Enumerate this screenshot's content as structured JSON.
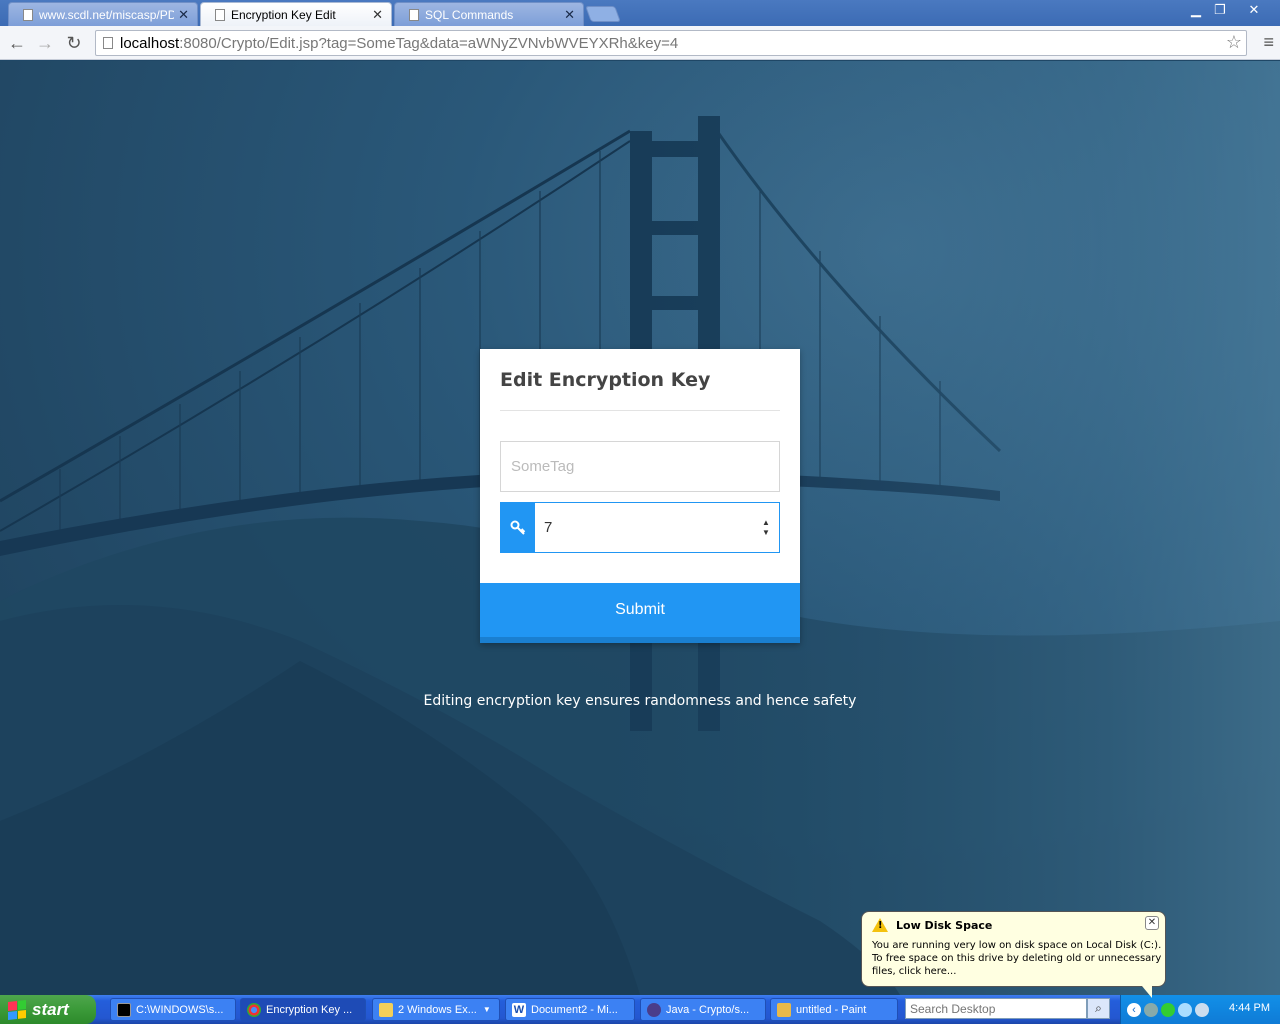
{
  "browser": {
    "tabs": [
      {
        "title": "www.scdl.net/miscasp/PDFS"
      },
      {
        "title": "Encryption Key Edit"
      },
      {
        "title": "SQL Commands"
      }
    ],
    "url_host": "localhost",
    "url_rest": ":8080/Crypto/Edit.jsp?tag=SomeTag&data=aWNyZVNvbWVEYXRh&key=4"
  },
  "form": {
    "title": "Edit Encryption Key",
    "tag_placeholder": "SomeTag",
    "key_value": "7",
    "submit_label": "Submit"
  },
  "tagline": "Editing encryption key ensures randomness and hence safety",
  "notification": {
    "title": "Low Disk Space",
    "body": "You are running very low on disk space on Local Disk (C:). To free space on this drive by deleting old or unnecessary files, click here..."
  },
  "taskbar": {
    "start_label": "start",
    "items": [
      {
        "label": "C:\\WINDOWS\\s..."
      },
      {
        "label": "Encryption Key ..."
      },
      {
        "label": "2 Windows Ex..."
      },
      {
        "label": "Document2 - Mi..."
      },
      {
        "label": "Java - Crypto/s..."
      },
      {
        "label": "untitled - Paint"
      }
    ],
    "search_placeholder": "Search Desktop",
    "clock": "4:44 PM"
  },
  "colors": {
    "accent": "#2196f3",
    "page_bg": "#224966"
  }
}
